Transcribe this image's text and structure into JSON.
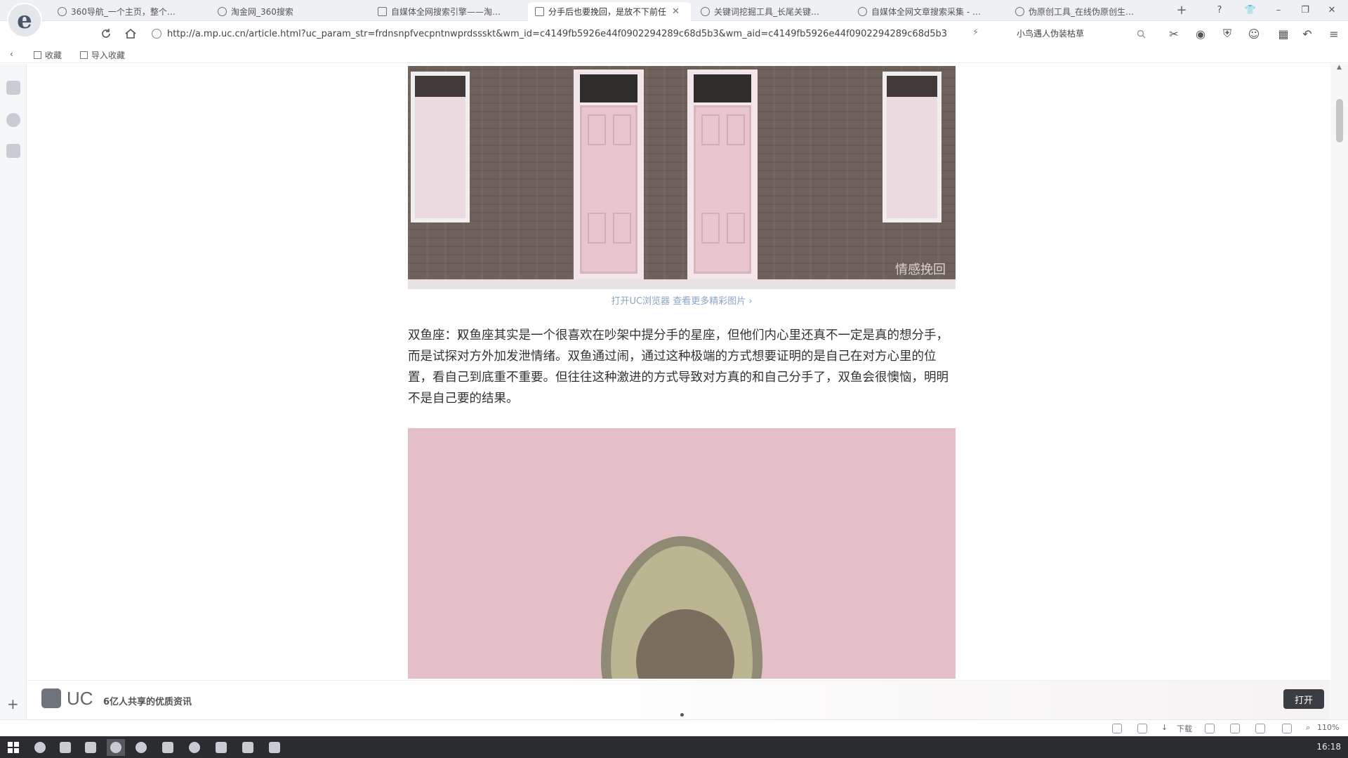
{
  "tabs": [
    {
      "label": "360导航_一个主页，整个世界",
      "active": false
    },
    {
      "label": "淘金网_360搜索",
      "active": false
    },
    {
      "label": "自媒体全网搜索引擎——淘金网",
      "active": false
    },
    {
      "label": "分手后也要挽回，是放不下前任",
      "active": true
    },
    {
      "label": "关键词挖掘工具_长尾关键词挖",
      "active": false
    },
    {
      "label": "自媒体全网文章搜索采集 - 5118",
      "active": false
    },
    {
      "label": "伪原创工具_在线伪原创生成_非",
      "active": false
    }
  ],
  "address": {
    "url": "http://a.mp.uc.cn/article.html?uc_param_str=frdnsnpfvecpntnwprdssskt&wm_id=c4149fb5926e44f0902294289c68d5b3&wm_aid=c4149fb5926e44f0902294289c68d5b3",
    "search_value": "小鸟遇人伪装枯草"
  },
  "bookmarks": {
    "collect": "收藏",
    "import": "导入收藏"
  },
  "article": {
    "image_caption": "打开UC浏览器 查看更多精彩图片 ›",
    "image_watermark": "情感挽回",
    "paragraph": "双鱼座：双鱼座其实是一个很喜欢在吵架中提分手的星座，但他们内心里还真不一定是真的想分手，而是试探对方外加发泄情绪。双鱼通过闹，通过这种极端的方式想要证明的是自己在对方心里的位置，看自己到底重不重要。但往往这种激进的方式导致对方真的和自己分手了，双鱼会很懊恼，明明不是自己要的结果。"
  },
  "uc_banner": {
    "name": "UC",
    "slogan": "6亿人共享的优质资讯",
    "open_button": "打开"
  },
  "statusbar": {
    "download": "下载",
    "zoom": "110%"
  },
  "taskbar": {
    "time": "16:18"
  }
}
